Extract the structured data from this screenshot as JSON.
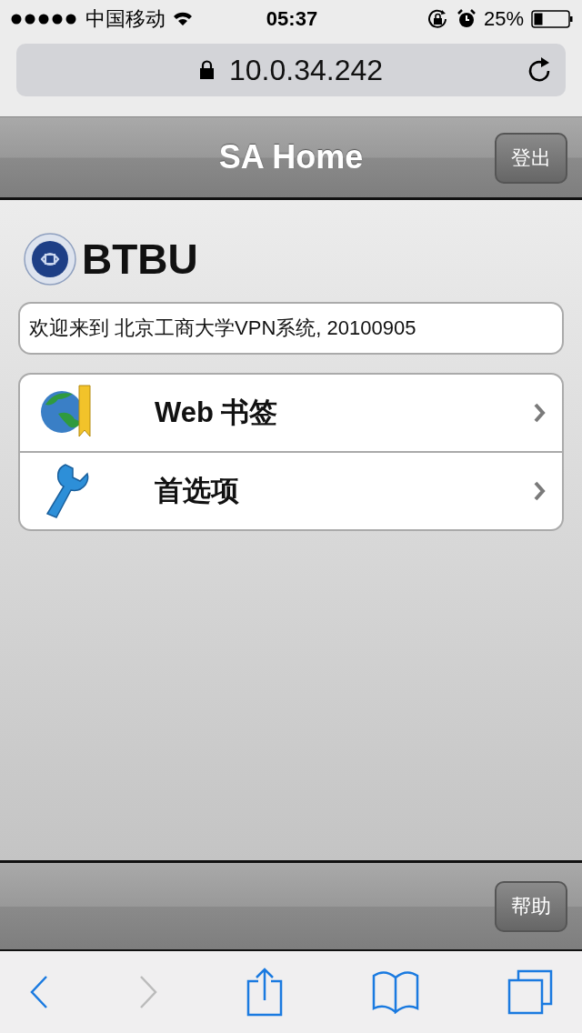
{
  "status_bar": {
    "carrier": "中国移动",
    "time": "05:37",
    "battery": "25%"
  },
  "address_bar": {
    "url": "10.0.34.242"
  },
  "header": {
    "title": "SA Home",
    "button": "登出"
  },
  "logo": {
    "text": "BTBU"
  },
  "welcome": "欢迎来到 北京工商大学VPN系统, 20100905",
  "menu": [
    {
      "label": "Web 书签",
      "kind": "bookmarks"
    },
    {
      "label": "首选项",
      "kind": "preferences"
    }
  ],
  "footer": {
    "button": "帮助"
  },
  "browser_toolbar": {
    "back_disabled": false,
    "forward_disabled": true
  }
}
